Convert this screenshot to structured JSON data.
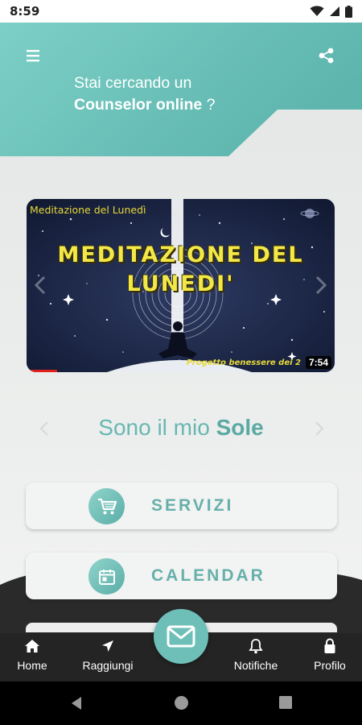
{
  "status_bar": {
    "time": "8:59"
  },
  "header": {
    "tagline_prefix": "Stai cercando un",
    "tagline_bold": "Counselor online",
    "tagline_suffix": " ?",
    "menu_icon": "hamburger-menu-icon",
    "share_icon": "share-icon",
    "accent_color": "#6cc2ba"
  },
  "video": {
    "corner_title": "Meditazione del Lunedì",
    "headline": "MEDITAZIONE DEL LUNEDI'",
    "footer": "Progetto benessere dei 2",
    "duration": "7:54"
  },
  "slogan": {
    "prefix": "Sono il mio ",
    "bold": "Sole"
  },
  "menu": [
    {
      "label": "SERVIZI",
      "icon": "shopping-cart-icon"
    },
    {
      "label": "CALENDAR",
      "icon": "calendar-icon"
    }
  ],
  "bottom_nav": [
    {
      "label": "Home",
      "icon": "home-icon"
    },
    {
      "label": "Raggiungi",
      "icon": "navigation-arrow-icon"
    },
    {
      "label": "Notifiche",
      "icon": "bell-icon"
    },
    {
      "label": "Profilo",
      "icon": "lock-icon"
    }
  ],
  "fab": {
    "icon": "mail-icon",
    "color": "#6dbfb8"
  }
}
